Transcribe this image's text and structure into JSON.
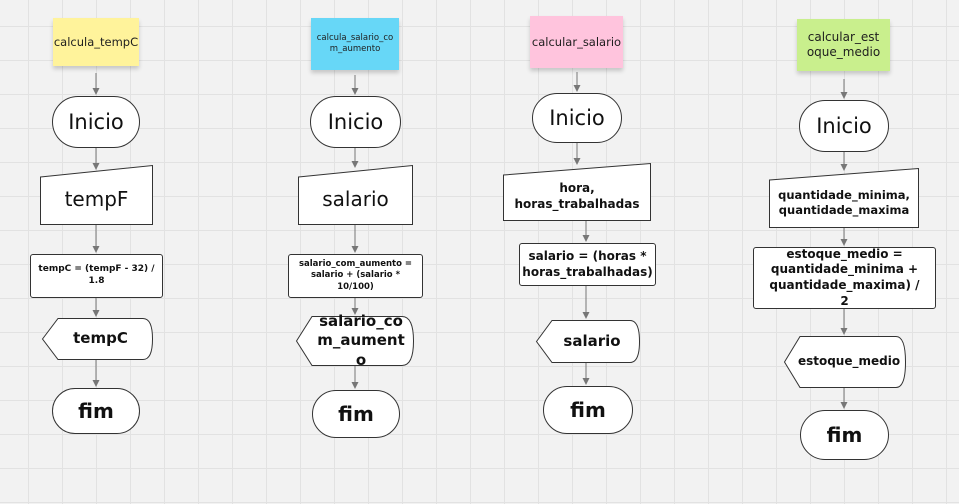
{
  "colors": {
    "yellow": "#fff39b",
    "blue": "#67d7f7",
    "pink": "#ffc4dd",
    "green": "#c9ef8d",
    "stroke": "#333333",
    "connector": "#777777"
  },
  "flowcharts": [
    {
      "title": "calcula_tempC",
      "start": "Inicio",
      "input": "tempF",
      "process": "tempC = (tempF - 32) / 1.8",
      "output": "tempC",
      "end": "fim"
    },
    {
      "title": "calcula_salario_com_aumento",
      "start": "Inicio",
      "input": "salario",
      "process": "salario_com_aumento = salario + (salario * 10/100)",
      "output": "salario_com_aumento",
      "end": "fim"
    },
    {
      "title": "calcular_salario",
      "start": "Inicio",
      "input": "hora, horas_trabalhadas",
      "process": "salario = (horas * horas_trabalhadas)",
      "output": "salario",
      "end": "fim"
    },
    {
      "title": "calcular_estoque_medio",
      "start": "Inicio",
      "input": "quantidade_minima, quantidade_maxima",
      "process": "estoque_medio = quantidade_minima + quantidade_maxima) / 2",
      "output": "estoque_medio",
      "end": "fim"
    }
  ]
}
